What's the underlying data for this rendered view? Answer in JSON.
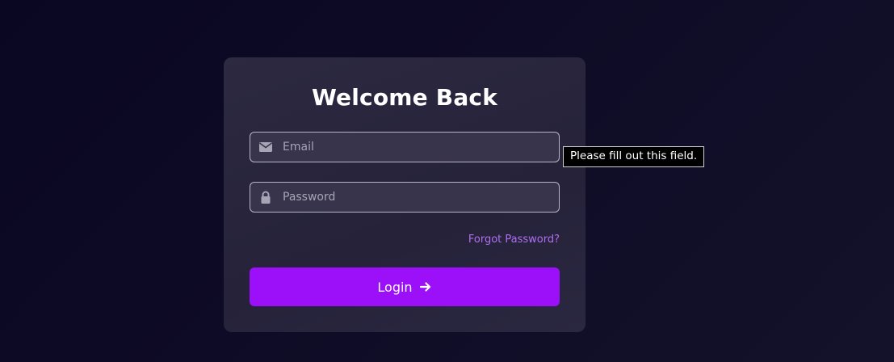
{
  "card": {
    "title": "Welcome Back"
  },
  "form": {
    "email": {
      "placeholder": "Email",
      "value": "",
      "icon": "envelope-icon"
    },
    "password": {
      "placeholder": "Password",
      "value": "",
      "icon": "lock-icon"
    },
    "forgot_label": "Forgot Password?",
    "login_label": "Login",
    "login_icon": "arrow-right-icon"
  },
  "validation_tooltip": "Please fill out this field.",
  "colors": {
    "accent": "#9b10f9",
    "link": "#b06ff0",
    "card": "#2a2740",
    "background": "#0c0924"
  }
}
